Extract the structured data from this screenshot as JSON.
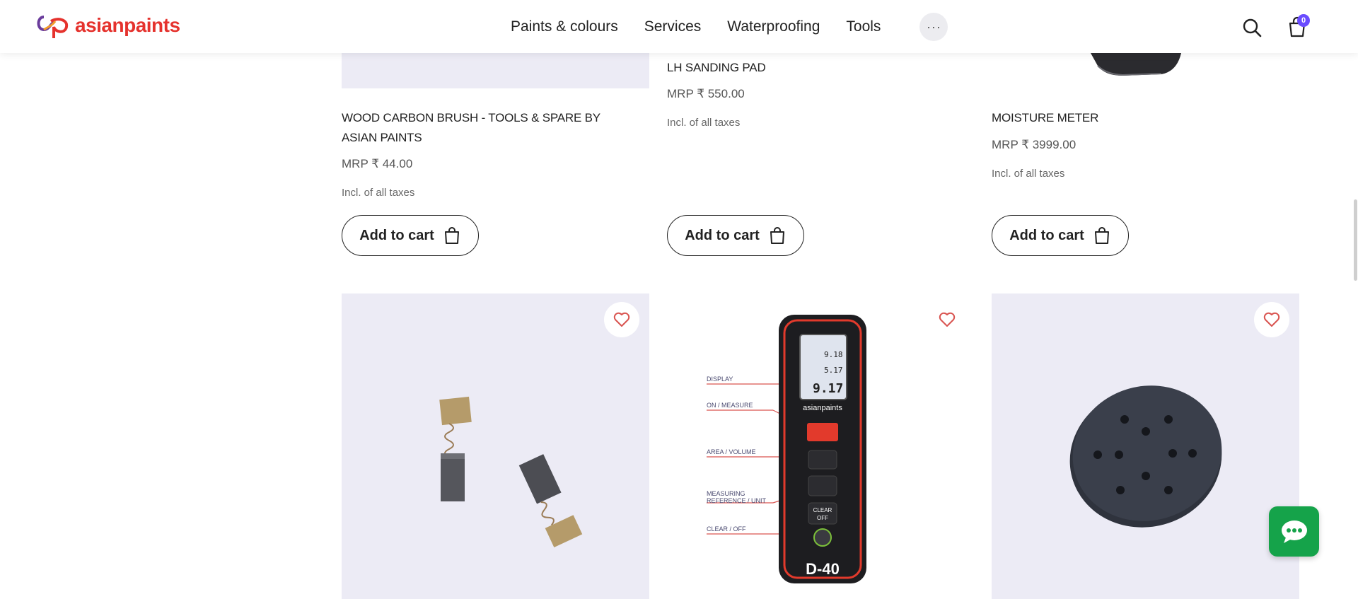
{
  "header": {
    "logo_text": "asianpaints",
    "nav": [
      "Paints & colours",
      "Services",
      "Waterproofing",
      "Tools"
    ],
    "more_label": "···",
    "cart_count": "0"
  },
  "products_top": [
    {
      "title": "WOOD CARBON BRUSH - TOOLS & SPARE BY ASIAN PAINTS",
      "price": "MRP ₹ 44.00",
      "tax": "Incl. of all taxes",
      "button": "Add to cart"
    },
    {
      "title": "LH SANDING PAD",
      "price": "MRP ₹ 550.00",
      "tax": "Incl. of all taxes",
      "button": "Add to cart"
    },
    {
      "title": "MOISTURE METER",
      "price": "MRP ₹ 3999.00",
      "tax": "Incl. of all taxes",
      "button": "Add to cart"
    }
  ],
  "laser_meter": {
    "callouts": [
      "DISPLAY",
      "ON / MEASURE",
      "AREA / VOLUME",
      "MEASURING",
      "REFERENCE / UNIT",
      "CLEAR / OFF"
    ],
    "brand": "asianpaints",
    "model": "D-40",
    "readings": [
      "9.18",
      "5.17",
      "9.17"
    ],
    "key_clear": "CLEAR",
    "key_off": "OFF"
  },
  "colors": {
    "brand_red": "#e5322d",
    "badge": "#6a4cff",
    "chat": "#15a34a",
    "fav_heart": "#d9534f",
    "image_bg": "#ecebf5"
  },
  "icons": {
    "search": "search-icon",
    "cart": "shopping-bag-icon",
    "wishlist": "heart-icon",
    "chat": "chat-bubble-icon"
  }
}
